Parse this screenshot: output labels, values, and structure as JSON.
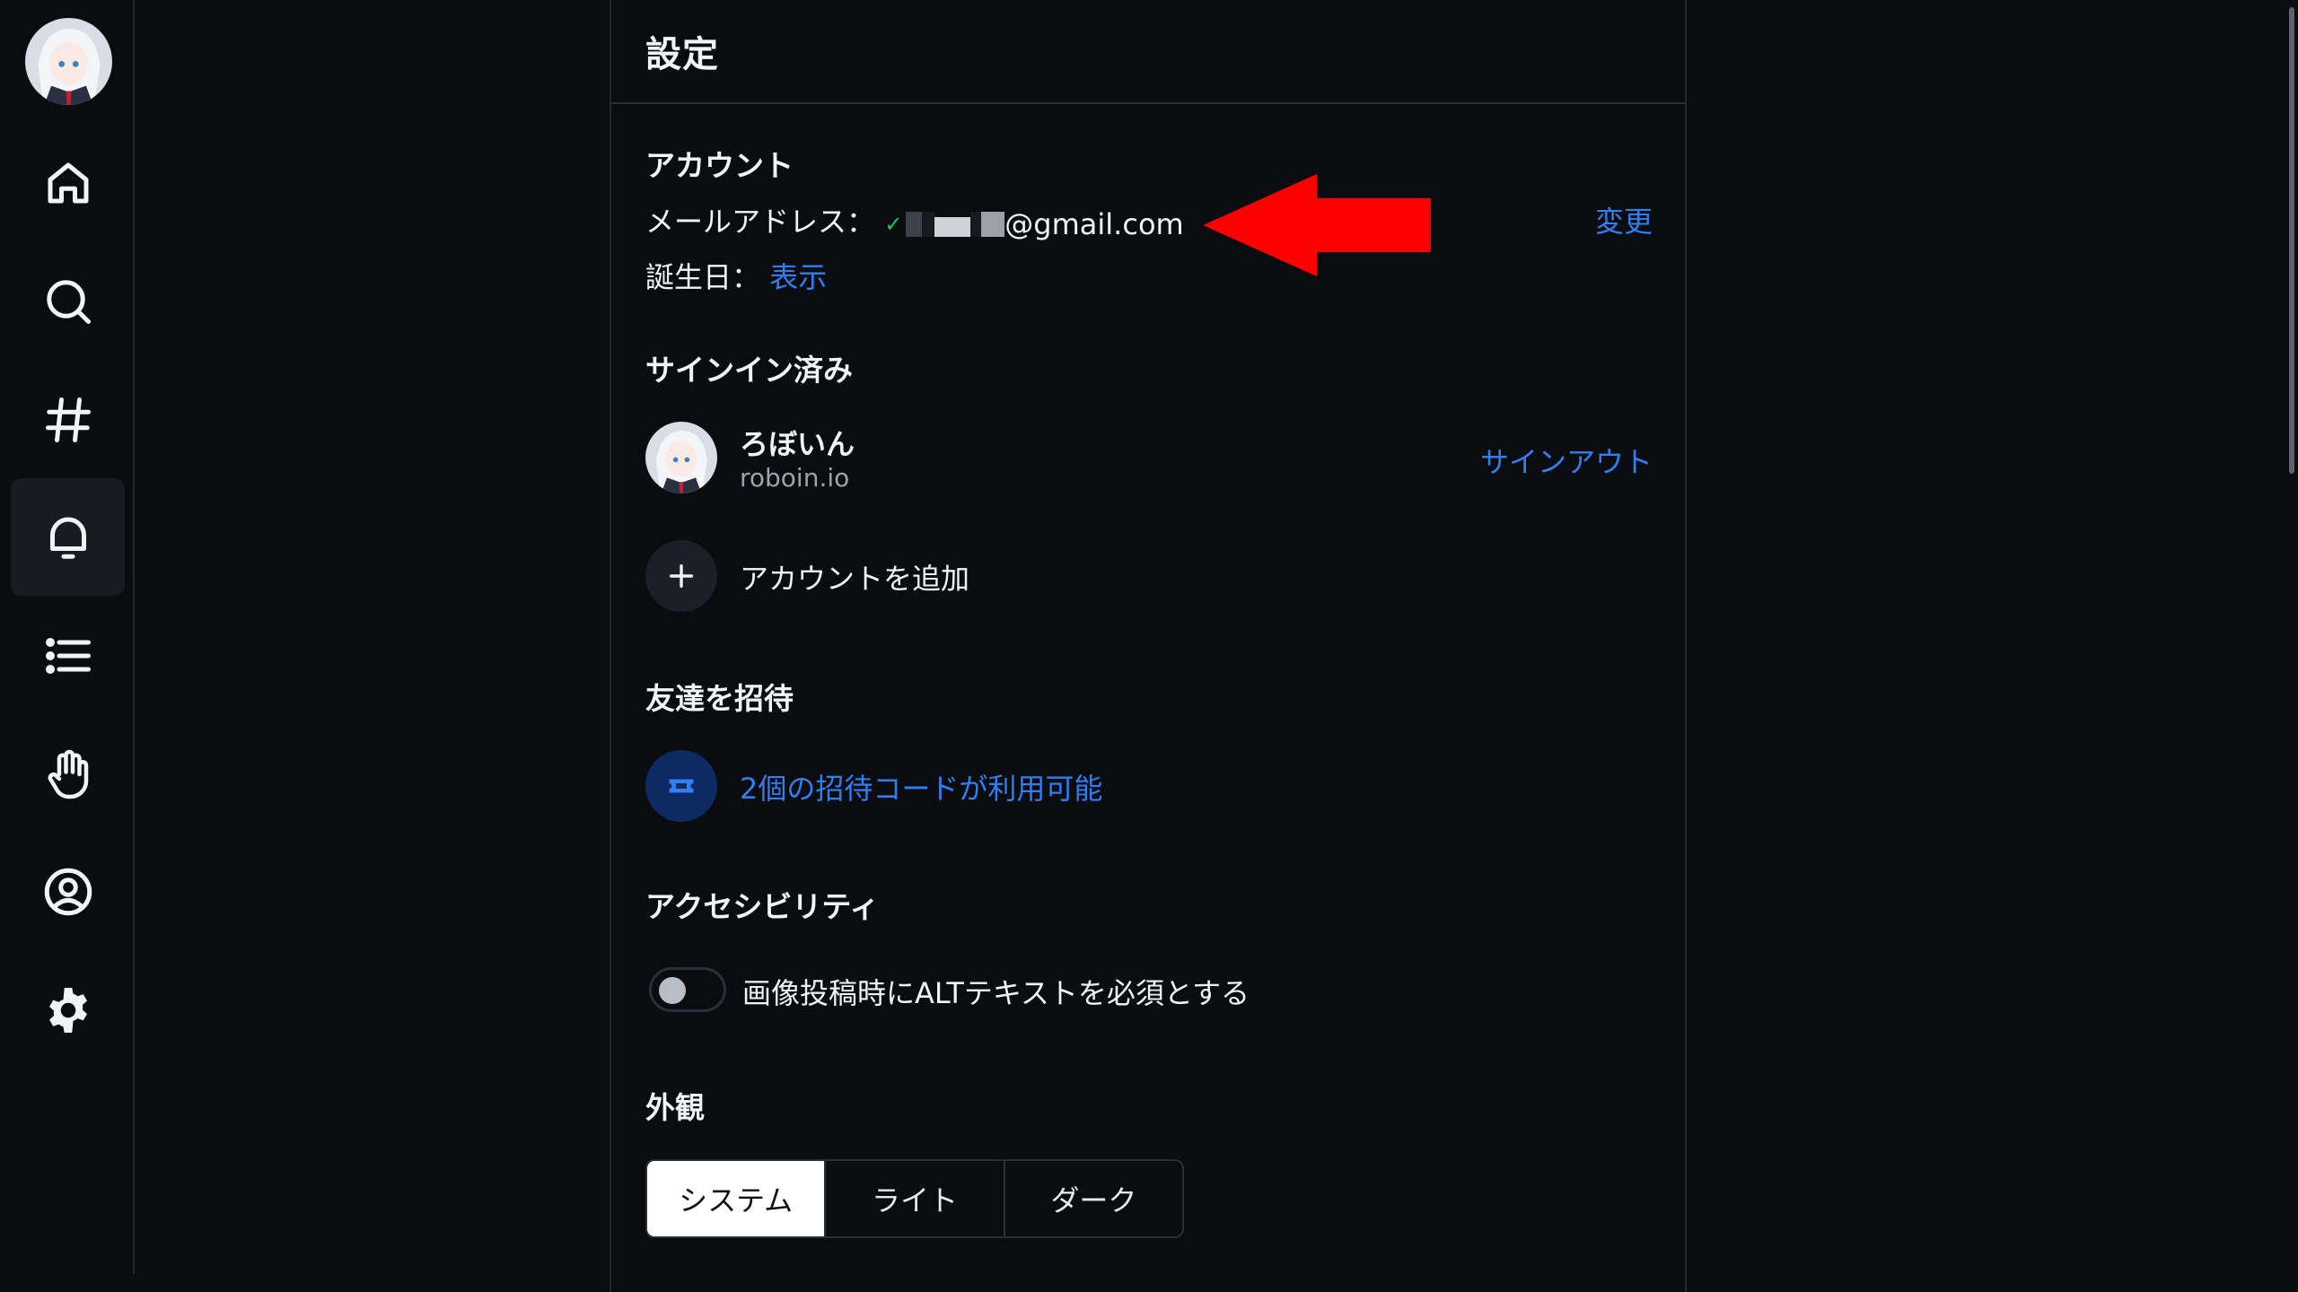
{
  "nav": {
    "items": [
      {
        "name": "home",
        "icon": "home-icon"
      },
      {
        "name": "search",
        "icon": "search-icon"
      },
      {
        "name": "feeds",
        "icon": "hashtag-icon"
      },
      {
        "name": "notifications",
        "icon": "bell-icon",
        "active": true
      },
      {
        "name": "lists",
        "icon": "list-icon"
      },
      {
        "name": "moderation",
        "icon": "hand-icon"
      },
      {
        "name": "profile",
        "icon": "user-circle-icon"
      },
      {
        "name": "settings",
        "icon": "gear-icon"
      }
    ]
  },
  "header": {
    "title": "設定"
  },
  "account": {
    "section_title": "アカウント",
    "email_label": "メールアドレス：",
    "email_value": "@gmail.com",
    "change_link": "変更",
    "birthday_label": "誕生日：",
    "birthday_link": "表示"
  },
  "signed_in": {
    "section_title": "サインイン済み",
    "display_name": "ろぼいん",
    "handle": "roboin.io",
    "signout_link": "サインアウト",
    "add_account_label": "アカウントを追加"
  },
  "invite": {
    "section_title": "友達を招待",
    "codes_link": "2個の招待コードが利用可能"
  },
  "accessibility": {
    "section_title": "アクセシビリティ",
    "require_alt_label": "画像投稿時にALTテキストを必須とする",
    "require_alt_enabled": false
  },
  "appearance": {
    "section_title": "外観",
    "options": [
      "システム",
      "ライト",
      "ダーク"
    ],
    "selected": "システム"
  },
  "colors": {
    "background": "#0a0c10",
    "link": "#2f7ff2",
    "annotation_arrow": "#ff0000"
  }
}
